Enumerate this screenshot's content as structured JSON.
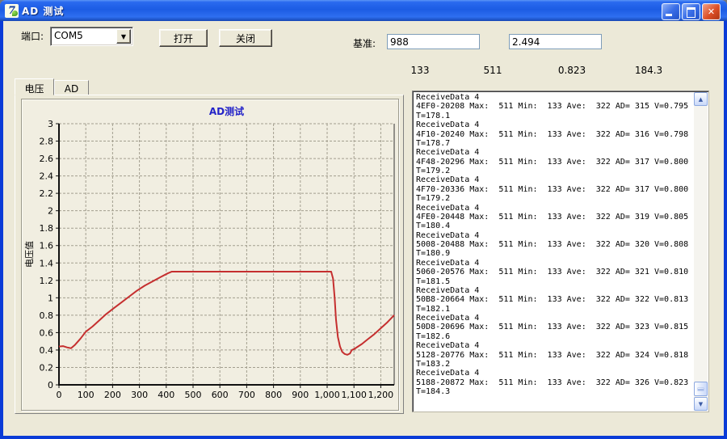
{
  "window": {
    "title": "AD 测试"
  },
  "icons": {
    "close": "✕",
    "dropdown": "▼",
    "scroll_up": "▲",
    "scroll_down": "▼",
    "app_glyph": "7"
  },
  "toolbar": {
    "port_label": "端口:",
    "port_value": "COM5",
    "open_button": "打开",
    "close_button": "关闭",
    "ref_label": "基准:",
    "ref_ad_value": "988",
    "ref_v_value": "2.494"
  },
  "stats": {
    "values": [
      "133",
      "511",
      "0.823",
      "184.3"
    ]
  },
  "tabs": [
    {
      "label": "电压",
      "selected": true
    },
    {
      "label": "AD",
      "selected": false
    }
  ],
  "chart_data": {
    "type": "line",
    "title": "AD测试",
    "xlabel": "",
    "ylabel": "电压值",
    "xlim": [
      0,
      1250
    ],
    "ylim": [
      0,
      3
    ],
    "grid": true,
    "legend": "none",
    "line_color": "#C52F2F",
    "title_color": "#2323C8",
    "grid_color": "#A39F8F",
    "plot_bg": "#F1EEE1",
    "x_ticks": [
      0,
      100,
      200,
      300,
      400,
      500,
      600,
      700,
      800,
      900,
      1000,
      1100,
      1200
    ],
    "x_tick_labels": [
      "0",
      "100",
      "200",
      "300",
      "400",
      "500",
      "600",
      "700",
      "800",
      "900",
      "1,000",
      "1,100",
      "1,200"
    ],
    "y_ticks": [
      0,
      0.2,
      0.4,
      0.6,
      0.8,
      1,
      1.2,
      1.4,
      1.6,
      1.8,
      2,
      2.2,
      2.4,
      2.6,
      2.8,
      3
    ],
    "y_tick_labels": [
      "0",
      "0.2",
      "0.4",
      "0.6",
      "0.8",
      "1",
      "1.2",
      "1.4",
      "1.6",
      "1.8",
      "2",
      "2.2",
      "2.4",
      "2.6",
      "2.8",
      "3"
    ],
    "points": [
      [
        0,
        0.44
      ],
      [
        15,
        0.445
      ],
      [
        30,
        0.43
      ],
      [
        45,
        0.42
      ],
      [
        60,
        0.46
      ],
      [
        80,
        0.53
      ],
      [
        100,
        0.61
      ],
      [
        125,
        0.67
      ],
      [
        150,
        0.74
      ],
      [
        175,
        0.81
      ],
      [
        200,
        0.87
      ],
      [
        230,
        0.94
      ],
      [
        260,
        1.01
      ],
      [
        290,
        1.08
      ],
      [
        320,
        1.14
      ],
      [
        350,
        1.19
      ],
      [
        380,
        1.24
      ],
      [
        405,
        1.28
      ],
      [
        420,
        1.3
      ],
      [
        500,
        1.3
      ],
      [
        600,
        1.3
      ],
      [
        700,
        1.3
      ],
      [
        800,
        1.3
      ],
      [
        900,
        1.3
      ],
      [
        1000,
        1.3
      ],
      [
        1015,
        1.3
      ],
      [
        1022,
        1.22
      ],
      [
        1028,
        1.0
      ],
      [
        1033,
        0.75
      ],
      [
        1040,
        0.55
      ],
      [
        1048,
        0.44
      ],
      [
        1056,
        0.38
      ],
      [
        1065,
        0.355
      ],
      [
        1075,
        0.345
      ],
      [
        1085,
        0.36
      ],
      [
        1092,
        0.4
      ],
      [
        1100,
        0.41
      ],
      [
        1115,
        0.44
      ],
      [
        1130,
        0.47
      ],
      [
        1150,
        0.52
      ],
      [
        1175,
        0.58
      ],
      [
        1200,
        0.65
      ],
      [
        1225,
        0.72
      ],
      [
        1250,
        0.8
      ]
    ]
  },
  "log": {
    "lines": [
      "ReceiveData 4",
      "4EF0-20208 Max:  511 Min:  133 Ave:  322 AD= 315 V=0.795",
      "T=178.1",
      "ReceiveData 4",
      "4F10-20240 Max:  511 Min:  133 Ave:  322 AD= 316 V=0.798",
      "T=178.7",
      "ReceiveData 4",
      "4F48-20296 Max:  511 Min:  133 Ave:  322 AD= 317 V=0.800",
      "T=179.2",
      "ReceiveData 4",
      "4F70-20336 Max:  511 Min:  133 Ave:  322 AD= 317 V=0.800",
      "T=179.2",
      "ReceiveData 4",
      "4FE0-20448 Max:  511 Min:  133 Ave:  322 AD= 319 V=0.805",
      "T=180.4",
      "ReceiveData 4",
      "5008-20488 Max:  511 Min:  133 Ave:  322 AD= 320 V=0.808",
      "T=180.9",
      "ReceiveData 4",
      "5060-20576 Max:  511 Min:  133 Ave:  322 AD= 321 V=0.810",
      "T=181.5",
      "ReceiveData 4",
      "50B8-20664 Max:  511 Min:  133 Ave:  322 AD= 322 V=0.813",
      "T=182.1",
      "ReceiveData 4",
      "50D8-20696 Max:  511 Min:  133 Ave:  322 AD= 323 V=0.815",
      "T=182.6",
      "ReceiveData 4",
      "5128-20776 Max:  511 Min:  133 Ave:  322 AD= 324 V=0.818",
      "T=183.2",
      "ReceiveData 4",
      "5188-20872 Max:  511 Min:  133 Ave:  322 AD= 326 V=0.823",
      "T=184.3"
    ]
  }
}
